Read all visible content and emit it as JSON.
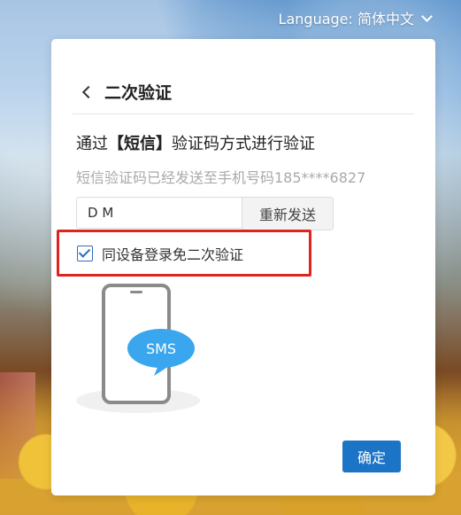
{
  "language": {
    "label": "Language: 简体中文"
  },
  "dialog": {
    "title": "二次验证",
    "method_prefix": "通过",
    "method_name": "【短信】",
    "method_suffix": "验证码方式进行验证",
    "sent_notice": "短信验证码已经发送至手机号码185****6827",
    "code_value": "D M",
    "resend_label": "重新发送",
    "remember_label": "同设备登录免二次验证",
    "remember_checked": true,
    "sms_bubble": "SMS",
    "confirm_label": "确定"
  },
  "colors": {
    "primary": "#1b74c5",
    "highlight_border": "#e0231f",
    "bubble": "#3aa6ee"
  }
}
